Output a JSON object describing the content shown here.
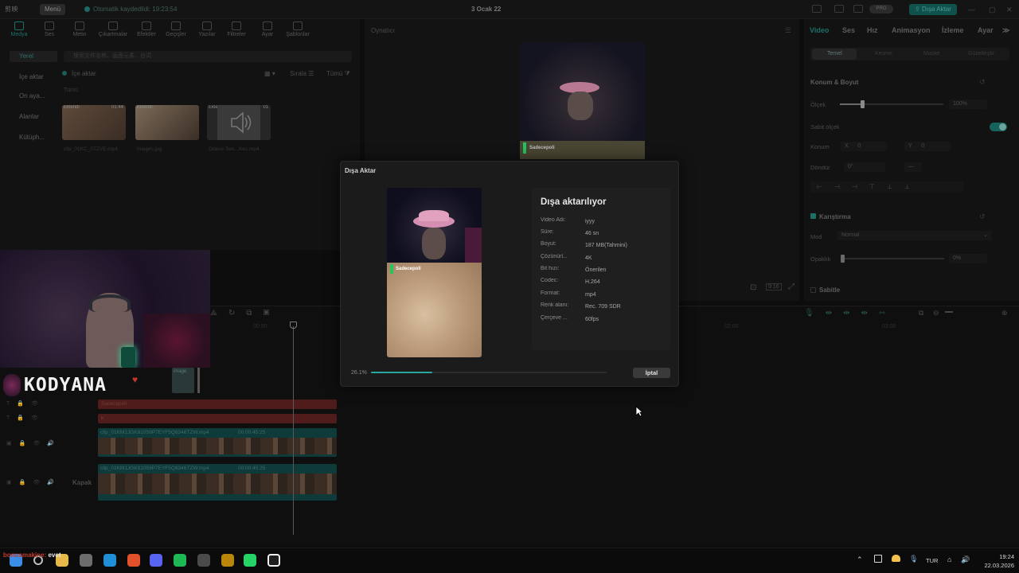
{
  "app": {
    "logo_text": "剪映",
    "menu_label": "Menü",
    "autosave_text": "Otomatik kaydedildi: 19:23:54",
    "project_title": "3 Ocak 22",
    "pro_badge": "PRO",
    "export_label": "Dışa Aktar",
    "window_controls": [
      "—",
      "▢",
      "✕"
    ]
  },
  "toolbar": {
    "tabs": [
      {
        "label": "Medya",
        "icon": "media-icon",
        "active": true
      },
      {
        "label": "Ses",
        "icon": "audio-icon"
      },
      {
        "label": "Metin",
        "icon": "text-icon"
      },
      {
        "label": "Çıkartmalar",
        "icon": "sticker-icon"
      },
      {
        "label": "Efektler",
        "icon": "effects-icon"
      },
      {
        "label": "Geçişler",
        "icon": "transitions-icon"
      },
      {
        "label": "Yazılar",
        "icon": "captions-icon"
      },
      {
        "label": "Filtreler",
        "icon": "filters-icon"
      },
      {
        "label": "Ayar",
        "icon": "adjust-icon"
      },
      {
        "label": "Şablonlar",
        "icon": "templates-icon"
      }
    ]
  },
  "sidebar": {
    "items": [
      {
        "label": "Yerel",
        "selected": true
      },
      {
        "label": "İçe aktar"
      },
      {
        "label": "On aya..."
      },
      {
        "label": "Alanlar"
      },
      {
        "label": "Kütüph..."
      }
    ]
  },
  "media": {
    "search_placeholder": "搜索文件名称、画面元素、台词",
    "import_label": "İçe aktar",
    "sort_label": "Sırala",
    "filter_label": "Tümü",
    "all_label": "Tümü",
    "items": [
      {
        "tag": "Eklendi",
        "duration": "01:44",
        "name": "clip_01KC_0TZVE.mp4"
      },
      {
        "tag": "Eklendi",
        "duration": "",
        "name": "images.jpg"
      },
      {
        "tag": "Eklendi",
        "duration": "01",
        "name": "Ödeve Sen...Kec.mp4"
      }
    ]
  },
  "player": {
    "label": "Oynatıcı",
    "ratio_label": "9:16",
    "watermark_text": "Sadecepoli"
  },
  "inspector": {
    "tabs": [
      {
        "label": "Video",
        "active": true
      },
      {
        "label": "Ses"
      },
      {
        "label": "Hız"
      },
      {
        "label": "Animasyon"
      },
      {
        "label": "İzleme"
      },
      {
        "label": "Ayar"
      }
    ],
    "subtabs": [
      {
        "label": "Temel",
        "active": true
      },
      {
        "label": "Kesme"
      },
      {
        "label": "Maske"
      },
      {
        "label": "Güzelleştir"
      }
    ],
    "position_size": {
      "title": "Konum & Boyut",
      "scale_label": "Ölçek",
      "scale_value": "100%",
      "scale_level": 0.5,
      "uniform_label": "Sabit ölçek",
      "position_label": "Konum",
      "x_label": "X",
      "x_value": "0",
      "y_label": "Y",
      "y_value": "0",
      "rotate_label": "Döndür",
      "rotate_value": "0°",
      "rotate_extra": "—"
    },
    "blend": {
      "title": "Karıştırma",
      "mode_label": "Mod",
      "mode_value": "Normal",
      "opacity_label": "Opaklık",
      "opacity_value": "0%",
      "opacity_level": 0.0
    },
    "stabilize_label": "Sabitle"
  },
  "timeline": {
    "time_marks": [
      "00:50",
      "02:00",
      "03:00"
    ],
    "tracks": [
      {
        "type": "text",
        "label": "Sadecepoli"
      },
      {
        "type": "text",
        "label": "k"
      },
      {
        "type": "video",
        "label": "clip_01KM1JGK81059P7EYF5Q8346TZW.mp4",
        "duration": "00:00:45:25"
      },
      {
        "type": "video",
        "label": "clip_01KM1JGK81059P7EYF5Q8346TZW.mp4",
        "duration": "00:00:45:25"
      }
    ],
    "cover_label": "Kapak",
    "overlay_clip_label": "image"
  },
  "stream": {
    "brand": "KODYANA"
  },
  "dialog": {
    "title": "Dışa Aktar",
    "heading": "Dışa aktarılıyor",
    "overlay_text": "Sadecepoli",
    "rows": [
      {
        "key": "Video Adı:",
        "value": "iyyy"
      },
      {
        "key": "Süre:",
        "value": "46 sn"
      },
      {
        "key": "Boyut:",
        "value": "187 MB(Tahmini)"
      },
      {
        "key": "Çözünürl...",
        "value": "4K"
      },
      {
        "key": "Bit hızı:",
        "value": "Önerilen"
      },
      {
        "key": "Codec:",
        "value": "H.264"
      },
      {
        "key": "Format:",
        "value": "mp4"
      },
      {
        "key": "Renk alanı:",
        "value": "Rec. 709 SDR"
      },
      {
        "key": "Çerçeve ...",
        "value": "60fps"
      }
    ],
    "progress_text": "26.1%",
    "progress": 0.261,
    "cancel_label": "İptal"
  },
  "chat": {
    "user": "bonusmakine:",
    "message": "evet"
  },
  "taskbar": {
    "apps": [
      {
        "icon": "windows-start-icon",
        "color": "#3a8ee6"
      },
      {
        "icon": "search-icon",
        "color": "#bdbdbd"
      },
      {
        "icon": "file-explorer-icon",
        "color": "#e8b84a"
      },
      {
        "icon": "store-icon",
        "color": "#6d6d6d"
      },
      {
        "icon": "edge-icon",
        "color": "#1f8fd6"
      },
      {
        "icon": "brave-icon",
        "color": "#e2532c"
      },
      {
        "icon": "discord-icon",
        "color": "#5865f2"
      },
      {
        "icon": "spotify-icon",
        "color": "#1db954"
      },
      {
        "icon": "obs-icon",
        "color": "#4a4a4a"
      },
      {
        "icon": "game-icon",
        "color": "#b8860b"
      },
      {
        "icon": "whatsapp-icon",
        "color": "#25d366"
      },
      {
        "icon": "capcut-icon",
        "color": "#f2f2f2"
      }
    ],
    "language": "TUR",
    "time": "19:24",
    "date": "22.03.2026"
  }
}
